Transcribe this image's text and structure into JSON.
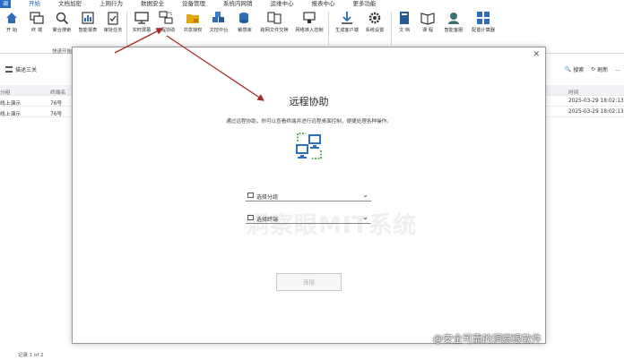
{
  "menubar": {
    "logo": "调",
    "items": [
      "开始",
      "文档加密",
      "上网行为",
      "数据安全",
      "设备管理",
      "系统内网销",
      "运维中心",
      "报表中心",
      "更多功能"
    ]
  },
  "ribbon": {
    "buttons": [
      "开 始",
      "终 端",
      "聚合搜索",
      "智能报表",
      "审批任务",
      "实时屏幕",
      "远程协助",
      "共享授权",
      "文控中台",
      "敏感库",
      "跨网文件交换",
      "网络准入控制",
      "生成客户端",
      "系统设置",
      "文 档",
      "课 程",
      "智能客服",
      "配置计算器"
    ],
    "group_label": "快速开始"
  },
  "subbar": {
    "left_label": "描述三关",
    "right_search": "搜索",
    "right_refresh": "刷新",
    "right_more": "..."
  },
  "bgtable": {
    "headers": [
      "分组",
      "终端名",
      "时间"
    ],
    "rows": [
      {
        "group": "线上演示",
        "terminal": "76号",
        "time": "2025-03-29 18:02:13"
      },
      {
        "group": "线上演示",
        "terminal": "76号",
        "time": "2025-03-29 18:02:13"
      }
    ]
  },
  "bottombar": {
    "text": "记录 1 of 2"
  },
  "modal": {
    "title": "远程协助",
    "description": "通过远程协助，你可以查看终端并进行远程桌面控制，便捷处理各种操作。",
    "select_group_placeholder": "选择分组",
    "select_terminal_placeholder": "选择终端",
    "connect_button": "连接",
    "watermark": "洞察眼MIT系统"
  },
  "credit": "@安全可靠的洞察眼软件",
  "colors": {
    "accent": "#1b5fb8",
    "arrow": "#a52a2a",
    "icon_blue": "#2e6fb5",
    "icon_green": "#3c8c3c"
  }
}
